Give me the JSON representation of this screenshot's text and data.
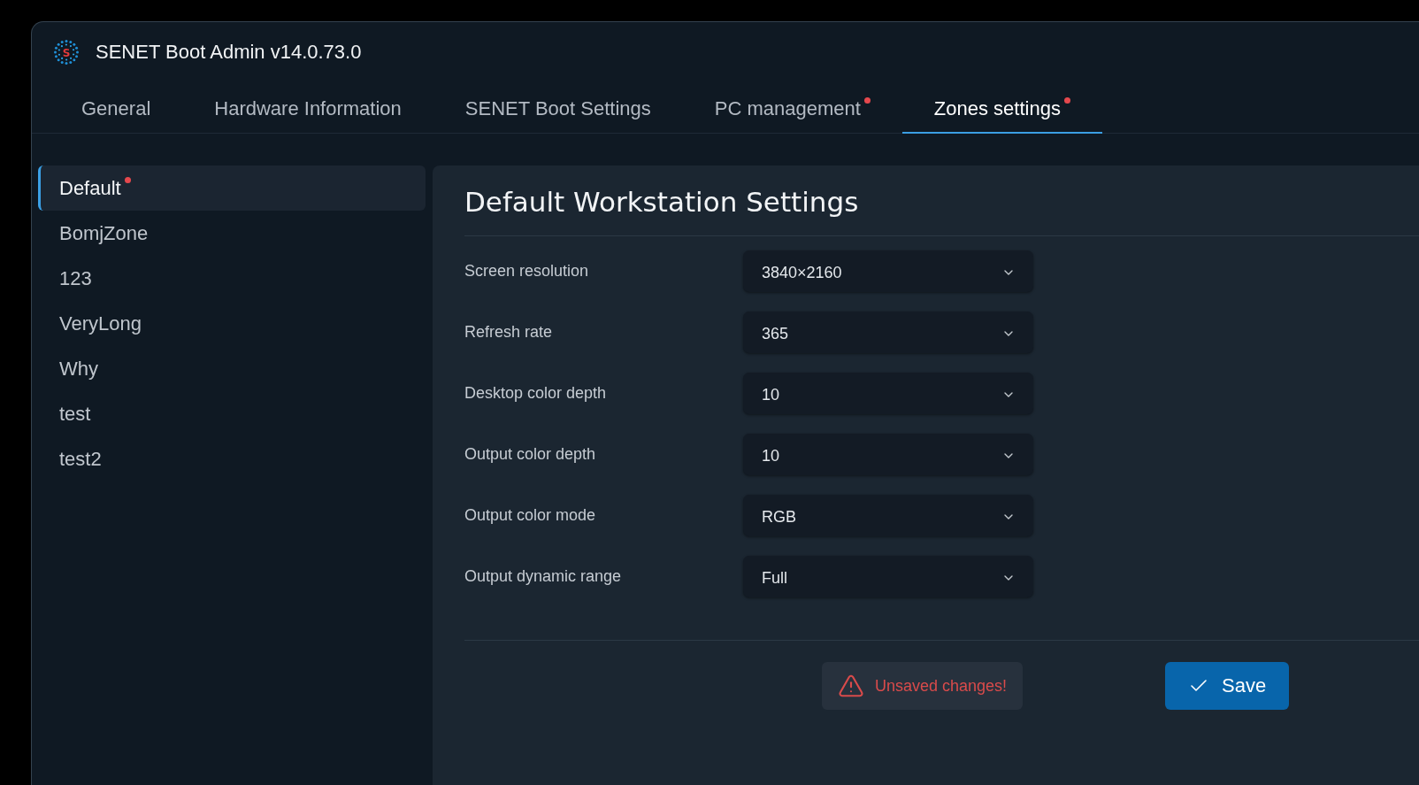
{
  "window": {
    "title": "SENET Boot Admin v14.0.73.0",
    "logo_letter": "S"
  },
  "tabs": [
    {
      "label": "General",
      "selected": false,
      "modified": false
    },
    {
      "label": "Hardware Information",
      "selected": false,
      "modified": false
    },
    {
      "label": "SENET Boot Settings",
      "selected": false,
      "modified": false
    },
    {
      "label": "PC management",
      "selected": false,
      "modified": true
    },
    {
      "label": "Zones settings",
      "selected": true,
      "modified": true
    }
  ],
  "sidebar": {
    "items": [
      {
        "label": "Default",
        "selected": true,
        "modified": true
      },
      {
        "label": "BomjZone",
        "selected": false,
        "modified": false
      },
      {
        "label": "123",
        "selected": false,
        "modified": false
      },
      {
        "label": "VeryLong",
        "selected": false,
        "modified": false
      },
      {
        "label": "Why",
        "selected": false,
        "modified": false
      },
      {
        "label": "test",
        "selected": false,
        "modified": false
      },
      {
        "label": "test2",
        "selected": false,
        "modified": false
      }
    ]
  },
  "panel": {
    "title": "Default Workstation Settings",
    "settings": [
      {
        "label": "Screen resolution",
        "value": "3840×2160"
      },
      {
        "label": "Refresh rate",
        "value": "365"
      },
      {
        "label": "Desktop color depth",
        "value": "10"
      },
      {
        "label": "Output color depth",
        "value": "10"
      },
      {
        "label": "Output color mode",
        "value": "RGB"
      },
      {
        "label": "Output dynamic range",
        "value": "Full"
      }
    ],
    "notice": {
      "text": "Unsaved changes!"
    },
    "save_button": {
      "label": "Save"
    }
  }
}
